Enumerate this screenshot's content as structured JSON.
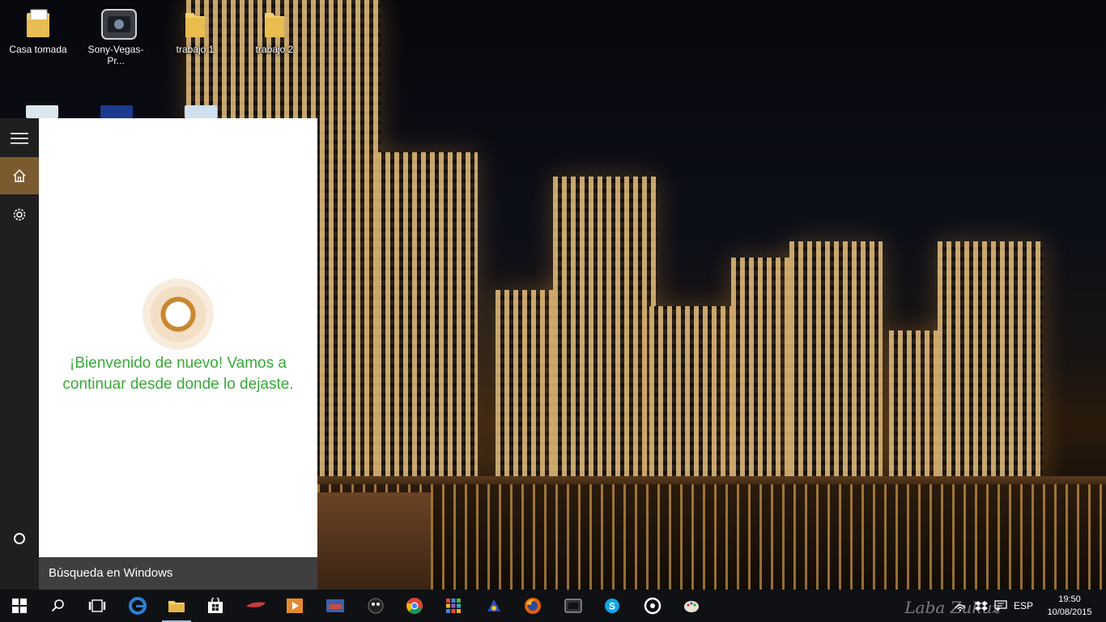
{
  "desktop": {
    "icons": [
      {
        "label": "Casa tomada",
        "icon": "document-folder-icon"
      },
      {
        "label": "Sony-Vegas-Pr...",
        "icon": "video-editor-icon"
      },
      {
        "label": "trabajo 1",
        "icon": "folder-icon"
      },
      {
        "label": "trabajo 2",
        "icon": "folder-icon"
      }
    ]
  },
  "cortana": {
    "rail": [
      "menu-icon",
      "home-icon",
      "settings-icon",
      "cortana-circle-icon"
    ],
    "welcome": "¡Bienvenido de nuevo! Vamos a continuar desde donde lo dejaste.",
    "search_label": "Búsqueda en Windows",
    "accent_color": "#7a5a2e",
    "text_color": "#3aa93a"
  },
  "taskbar": {
    "apps": [
      "start-icon",
      "search-icon",
      "task-view-icon",
      "edge-icon",
      "file-explorer-icon",
      "store-icon",
      "app-icon",
      "media-player-icon",
      "app-icon",
      "app-icon",
      "chrome-icon",
      "apps-grid-icon",
      "app-icon",
      "firefox-icon",
      "app-icon",
      "skype-icon",
      "groove-icon",
      "paint-icon"
    ],
    "language": "ESP",
    "time": "19:50",
    "date": "10/08/2015"
  }
}
